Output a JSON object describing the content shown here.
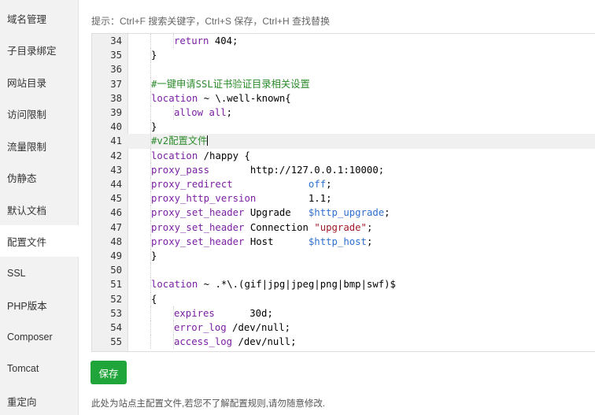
{
  "sidebar": {
    "items": [
      {
        "label": "域名管理"
      },
      {
        "label": "子目录绑定"
      },
      {
        "label": "网站目录"
      },
      {
        "label": "访问限制"
      },
      {
        "label": "流量限制"
      },
      {
        "label": "伪静态"
      },
      {
        "label": "默认文档"
      },
      {
        "label": "配置文件",
        "active": true
      },
      {
        "label": "SSL"
      },
      {
        "label": "PHP版本"
      },
      {
        "label": "Composer"
      },
      {
        "label": "Tomcat"
      },
      {
        "label": "重定向"
      }
    ]
  },
  "main": {
    "tip": "提示：Ctrl+F 搜索关键字，Ctrl+S 保存，Ctrl+H 查找替换",
    "save_label": "保存",
    "footnote": "此处为站点主配置文件,若您不了解配置规则,请勿随意修改."
  },
  "editor": {
    "active_line": 41,
    "colors": {
      "keyword": "#7a1fa2",
      "comment": "#2b8a2b",
      "variable": "#2f6fd0",
      "string": "#a0182b"
    },
    "lines": [
      {
        "n": "34",
        "indent": 2,
        "tokens": [
          {
            "t": "return",
            "c": "kw"
          },
          {
            "t": " 404;"
          }
        ]
      },
      {
        "n": "35",
        "indent": 1,
        "tokens": [
          {
            "t": "}"
          }
        ]
      },
      {
        "n": "36",
        "indent": 1,
        "tokens": []
      },
      {
        "n": "37",
        "indent": 1,
        "tokens": [
          {
            "t": "#一键申请SSL证书验证目录相关设置",
            "c": "cm"
          }
        ]
      },
      {
        "n": "38",
        "indent": 1,
        "tokens": [
          {
            "t": "location",
            "c": "kw"
          },
          {
            "t": " ~ \\.well-known{"
          }
        ]
      },
      {
        "n": "39",
        "indent": 2,
        "tokens": [
          {
            "t": "allow",
            "c": "kw"
          },
          {
            "t": " "
          },
          {
            "t": "all",
            "c": "kw"
          },
          {
            "t": ";"
          }
        ]
      },
      {
        "n": "40",
        "indent": 1,
        "tokens": [
          {
            "t": "}"
          }
        ]
      },
      {
        "n": "41",
        "indent": 1,
        "tokens": [
          {
            "t": "#v2配置文件",
            "c": "cm"
          }
        ],
        "cursor": true
      },
      {
        "n": "42",
        "indent": 1,
        "tokens": [
          {
            "t": "location",
            "c": "kw"
          },
          {
            "t": " /happy {"
          }
        ]
      },
      {
        "n": "43",
        "indent": 1,
        "tokens": [
          {
            "t": "proxy_pass",
            "c": "kw"
          },
          {
            "t": "       http://127.0.0.1:10000;"
          }
        ]
      },
      {
        "n": "44",
        "indent": 1,
        "tokens": [
          {
            "t": "proxy_redirect",
            "c": "kw"
          },
          {
            "t": "             "
          },
          {
            "t": "off",
            "c": "vr"
          },
          {
            "t": ";"
          }
        ]
      },
      {
        "n": "45",
        "indent": 1,
        "tokens": [
          {
            "t": "proxy_http_version",
            "c": "kw"
          },
          {
            "t": "         1.1;"
          }
        ]
      },
      {
        "n": "46",
        "indent": 1,
        "tokens": [
          {
            "t": "proxy_set_header",
            "c": "kw"
          },
          {
            "t": " Upgrade   "
          },
          {
            "t": "$http_upgrade",
            "c": "vr"
          },
          {
            "t": ";"
          }
        ]
      },
      {
        "n": "47",
        "indent": 1,
        "tokens": [
          {
            "t": "proxy_set_header",
            "c": "kw"
          },
          {
            "t": " Connection "
          },
          {
            "t": "\"upgrade\"",
            "c": "st"
          },
          {
            "t": ";"
          }
        ]
      },
      {
        "n": "48",
        "indent": 1,
        "tokens": [
          {
            "t": "proxy_set_header",
            "c": "kw"
          },
          {
            "t": " Host      "
          },
          {
            "t": "$http_host",
            "c": "vr"
          },
          {
            "t": ";"
          }
        ]
      },
      {
        "n": "49",
        "indent": 1,
        "tokens": [
          {
            "t": "}"
          }
        ]
      },
      {
        "n": "50",
        "indent": 1,
        "tokens": []
      },
      {
        "n": "51",
        "indent": 1,
        "tokens": [
          {
            "t": "location",
            "c": "kw"
          },
          {
            "t": " ~ .*\\.(gif|jpg|jpeg|png|bmp|swf)$"
          }
        ]
      },
      {
        "n": "52",
        "indent": 1,
        "tokens": [
          {
            "t": "{"
          }
        ]
      },
      {
        "n": "53",
        "indent": 2,
        "tokens": [
          {
            "t": "expires",
            "c": "kw"
          },
          {
            "t": "      30d;"
          }
        ]
      },
      {
        "n": "54",
        "indent": 2,
        "tokens": [
          {
            "t": "error_log",
            "c": "kw"
          },
          {
            "t": " /dev/null;"
          }
        ]
      },
      {
        "n": "55",
        "indent": 2,
        "tokens": [
          {
            "t": "access_log",
            "c": "kw"
          },
          {
            "t": " /dev/null;"
          }
        ]
      }
    ]
  }
}
